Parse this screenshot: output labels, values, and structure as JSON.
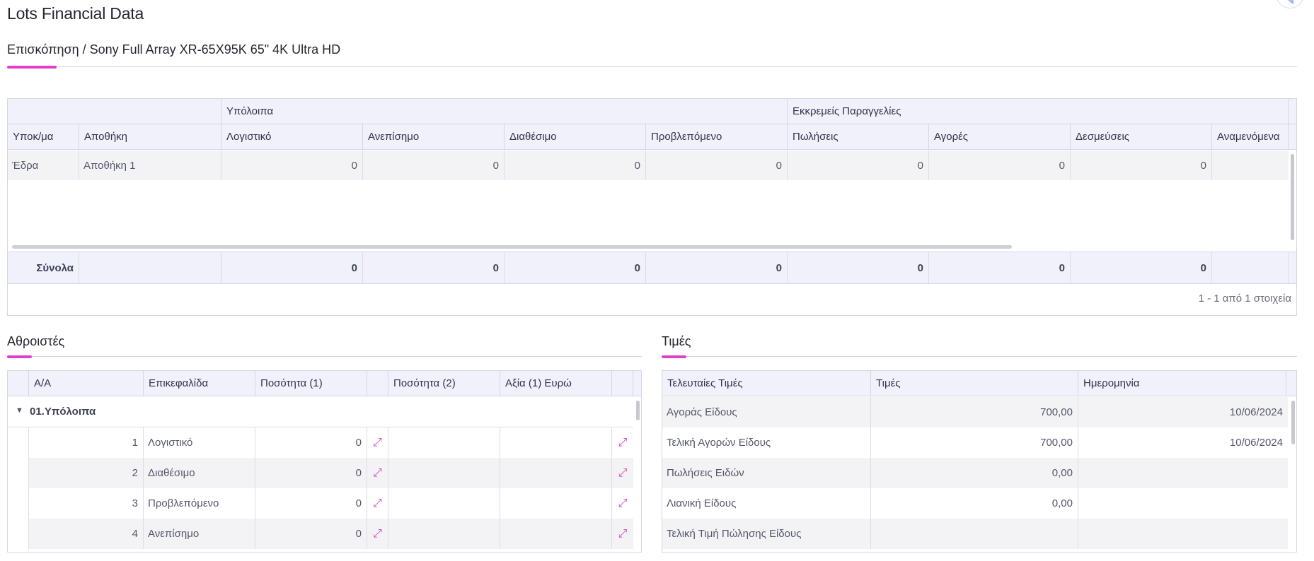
{
  "page": {
    "title": "Lots Financial Data"
  },
  "overview": {
    "breadcrumb": "Επισκόπηση / Sony Full Array XR-65X95K 65\" 4K Ultra HD",
    "group_headers": [
      "Υπόλοιπα",
      "Εκκρεμείς Παραγγελίες"
    ],
    "columns": [
      "Υποκ/μα",
      "Αποθήκη",
      "Λογιστικό",
      "Ανεπίσημο",
      "Διαθέσιμο",
      "Προβλεπόμενο",
      "Πωλήσεις",
      "Αγορές",
      "Δεσμεύσεις",
      "Αναμενόμενα"
    ],
    "rows": [
      {
        "branch": "Έδρα",
        "warehouse": "Αποθήκη 1",
        "values": [
          "0",
          "0",
          "0",
          "0",
          "0",
          "0",
          "0"
        ]
      }
    ],
    "totals_label": "Σύνολα",
    "totals": [
      "0",
      "0",
      "0",
      "0",
      "0",
      "0",
      "0"
    ],
    "pager": "1 - 1 από 1 στοιχεία"
  },
  "accumulators": {
    "title": "Αθροιστές",
    "columns": [
      "Α/Α",
      "Επικεφαλίδα",
      "Ποσότητα (1)",
      "",
      "Ποσότητα (2)",
      "Αξία (1) Ευρώ",
      ""
    ],
    "group_label": "01.Υπόλοιπα",
    "rows": [
      {
        "no": "1",
        "heading": "Λογιστικό",
        "qty1": "0"
      },
      {
        "no": "2",
        "heading": "Διαθέσιμο",
        "qty1": "0"
      },
      {
        "no": "3",
        "heading": "Προβλεπόμενο",
        "qty1": "0"
      },
      {
        "no": "4",
        "heading": "Ανεπίσημο",
        "qty1": "0"
      }
    ],
    "expand_glyph": "⤢"
  },
  "prices": {
    "title": "Τιμές",
    "columns": [
      "Τελευταίες Τιμές",
      "Τιμές",
      "Ημερομηνία"
    ],
    "rows": [
      {
        "label": "Αγοράς Είδους",
        "price": "700,00",
        "date": "10/06/2024"
      },
      {
        "label": "Τελική Αγορών Είδους",
        "price": "700,00",
        "date": "10/06/2024"
      },
      {
        "label": "Πωλήσεις Ειδών",
        "price": "0,00",
        "date": ""
      },
      {
        "label": "Λιανική Είδους",
        "price": "0,00",
        "date": ""
      },
      {
        "label": "Τελική Τιμή Πώλησης Είδους",
        "price": "",
        "date": ""
      }
    ]
  },
  "colors": {
    "accent": "#e040c8",
    "header_bg": "#f1f1fb",
    "border": "#d5d6e4"
  },
  "icons": {
    "corner": "edit-icon",
    "expand": "expand-icon",
    "group_toggle": "caret-down-icon"
  }
}
